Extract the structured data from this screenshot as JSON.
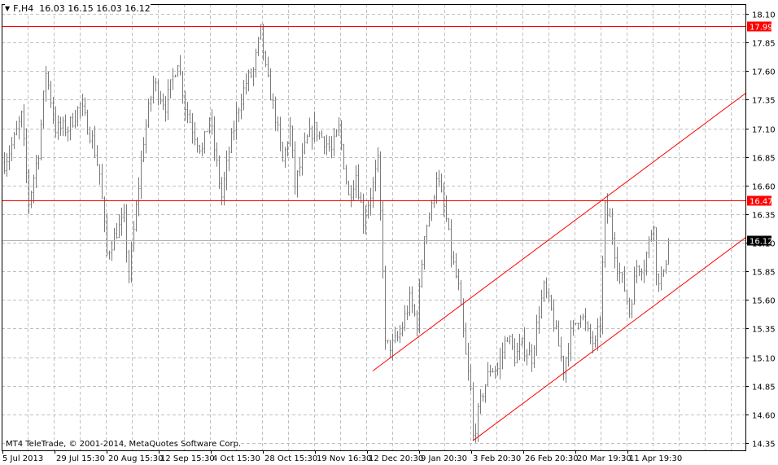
{
  "header": {
    "arrow_icon": "triangle-down-icon",
    "symbol": "F,H4",
    "ohlc": "16.03 16.15 16.03 16.12"
  },
  "footer": {
    "copyright": "MT4 TeleTrade, © 2001-2014, MetaQuotes Software Corp."
  },
  "colors": {
    "bars": "#7a7a7a",
    "lines": "#ff0000",
    "grid": "#c0c0c0",
    "current": "#000000"
  },
  "chart_data": {
    "type": "ohlc",
    "title": "F,H4",
    "ylim": [
      14.35,
      18.1
    ],
    "y_ticks": [
      "18.10",
      "17.85",
      "17.60",
      "17.35",
      "17.10",
      "16.85",
      "16.60",
      "16.35",
      "16.10",
      "15.85",
      "15.60",
      "15.35",
      "15.10",
      "14.85",
      "14.60",
      "14.35"
    ],
    "x_ticks": [
      "5 Jul 2013",
      "29 Jul 15:30",
      "20 Aug 15:30",
      "12 Sep 15:30",
      "4 Oct 15:30",
      "28 Oct 15:30",
      "19 Nov 16:30",
      "12 Dec 20:30",
      "9 Jan 20:30",
      "3 Feb 20:30",
      "26 Feb 20:30",
      "20 Mar 19:30",
      "11 Apr 19:30"
    ],
    "price_path_note_units": "bar index / price",
    "price_path": [
      [
        1,
        16.8
      ],
      [
        5,
        17.0
      ],
      [
        8,
        17.2
      ],
      [
        11,
        16.45
      ],
      [
        15,
        16.9
      ],
      [
        18,
        17.6
      ],
      [
        22,
        17.1
      ],
      [
        27,
        17.1
      ],
      [
        32,
        17.3
      ],
      [
        37,
        17.0
      ],
      [
        40,
        16.7
      ],
      [
        43,
        16.0
      ],
      [
        47,
        16.2
      ],
      [
        50,
        16.3
      ],
      [
        52,
        15.8
      ],
      [
        55,
        16.4
      ],
      [
        58,
        17.0
      ],
      [
        62,
        17.5
      ],
      [
        67,
        17.3
      ],
      [
        72,
        17.7
      ],
      [
        75,
        17.3
      ],
      [
        78,
        17.1
      ],
      [
        82,
        16.9
      ],
      [
        85,
        17.2
      ],
      [
        90,
        16.5
      ],
      [
        93,
        16.9
      ],
      [
        97,
        17.3
      ],
      [
        100,
        17.5
      ],
      [
        103,
        17.6
      ],
      [
        106,
        17.95
      ],
      [
        108,
        17.6
      ],
      [
        112,
        17.2
      ],
      [
        115,
        16.8
      ],
      [
        118,
        17.1
      ],
      [
        120,
        16.6
      ],
      [
        125,
        17.0
      ],
      [
        128,
        17.1
      ],
      [
        132,
        17.0
      ],
      [
        135,
        16.9
      ],
      [
        138,
        17.1
      ],
      [
        142,
        16.5
      ],
      [
        145,
        16.7
      ],
      [
        148,
        16.3
      ],
      [
        152,
        16.6
      ],
      [
        154,
        16.8
      ],
      [
        156,
        15.9
      ],
      [
        157,
        15.2
      ],
      [
        160,
        15.2
      ],
      [
        163,
        15.3
      ],
      [
        167,
        15.6
      ],
      [
        170,
        15.4
      ],
      [
        173,
        16.2
      ],
      [
        176,
        16.4
      ],
      [
        178,
        16.7
      ],
      [
        182,
        16.3
      ],
      [
        184,
        16.0
      ],
      [
        187,
        15.7
      ],
      [
        190,
        15.1
      ],
      [
        192,
        14.8
      ],
      [
        193,
        14.4
      ],
      [
        197,
        14.8
      ],
      [
        200,
        15.0
      ],
      [
        203,
        15.0
      ],
      [
        207,
        15.3
      ],
      [
        210,
        15.1
      ],
      [
        213,
        15.2
      ],
      [
        217,
        15.1
      ],
      [
        220,
        15.5
      ],
      [
        222,
        15.7
      ],
      [
        225,
        15.5
      ],
      [
        228,
        15.2
      ],
      [
        230,
        15.0
      ],
      [
        233,
        15.3
      ],
      [
        237,
        15.5
      ],
      [
        240,
        15.3
      ],
      [
        243,
        15.2
      ],
      [
        245,
        15.4
      ],
      [
        247,
        16.4
      ],
      [
        249,
        16.3
      ],
      [
        252,
        15.9
      ],
      [
        255,
        15.7
      ],
      [
        257,
        15.5
      ],
      [
        260,
        15.9
      ],
      [
        263,
        15.9
      ],
      [
        267,
        16.3
      ],
      [
        268,
        15.8
      ],
      [
        271,
        15.8
      ],
      [
        273,
        16.12
      ]
    ],
    "horizontal_levels": [
      {
        "price": 17.99,
        "label": "17.99"
      },
      {
        "price": 16.47,
        "label": "16.47"
      }
    ],
    "current_price": {
      "price": 16.12,
      "label": "16.12"
    },
    "trend_lines": [
      {
        "name": "lower-channel",
        "from": [
          193,
          14.37
        ],
        "to": [
          305,
          16.15
        ]
      },
      {
        "name": "upper-channel",
        "from": [
          152,
          14.98
        ],
        "to": [
          305,
          17.41
        ]
      }
    ]
  }
}
